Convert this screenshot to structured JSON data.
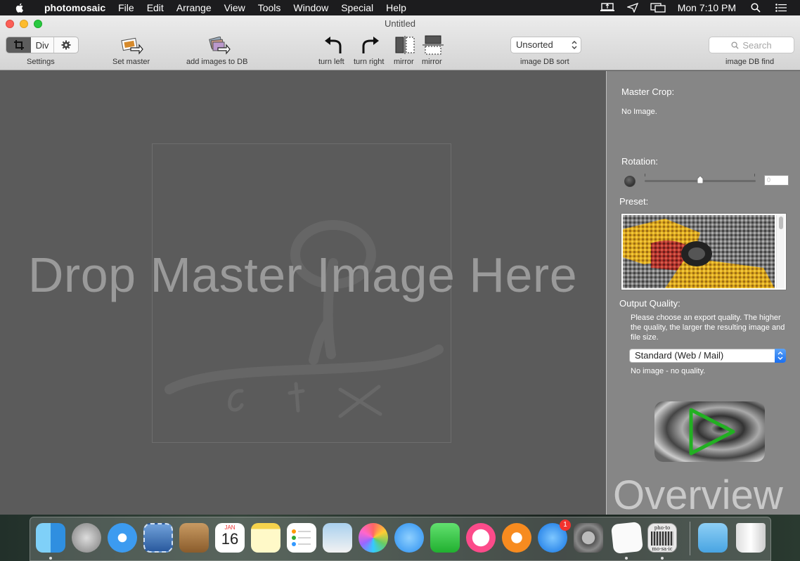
{
  "menubar": {
    "app_name": "photomosaic",
    "items": [
      "File",
      "Edit",
      "Arrange",
      "View",
      "Tools",
      "Window",
      "Special",
      "Help"
    ],
    "clock": "Mon 7:10 PM"
  },
  "window": {
    "title": "Untitled"
  },
  "toolbar": {
    "settings_label": "Settings",
    "div_label": "Div",
    "set_master_label": "Set master",
    "add_images_label": "add images to DB",
    "turn_left_label": "turn left",
    "turn_right_label": "turn right",
    "mirror_h_label": "mirror",
    "mirror_v_label": "mirror",
    "sort_value": "Unsorted",
    "sort_label": "image DB sort",
    "search_placeholder": "Search",
    "find_label": "image DB find"
  },
  "drop_area": {
    "text": "Drop Master Image Here"
  },
  "panel": {
    "master_crop_label": "Master Crop:",
    "master_crop_status": "No Image.",
    "rotation_label": "Rotation:",
    "rotation_value": "0",
    "preset_label": "Preset:",
    "output_quality_label": "Output Quality:",
    "output_quality_desc": "Please choose an export quality. The higher the quality, the larger the resulting image and file size.",
    "quality_selected": "Standard (Web / Mail)",
    "quality_status": "No image - no quality.",
    "overview_label": "Overview"
  },
  "dock": {
    "items": [
      "finder-icon",
      "launchpad-icon",
      "safari-icon",
      "mail-icon",
      "contacts-icon",
      "calendar-icon",
      "notes-icon",
      "reminders-icon",
      "preview-icon",
      "photos-icon",
      "messages-icon",
      "facetime-icon",
      "itunes-icon",
      "ibooks-icon",
      "app-store-icon",
      "system-preferences-icon",
      "textedit-icon",
      "photomosaic-icon",
      "downloads-folder-icon",
      "trash-icon"
    ],
    "calendar_month": "JAN",
    "calendar_day": "16",
    "app_store_badge": "1",
    "photomosaic_icon_text_1": "pho·to",
    "photomosaic_icon_text_2": "mo·sa·ic"
  }
}
